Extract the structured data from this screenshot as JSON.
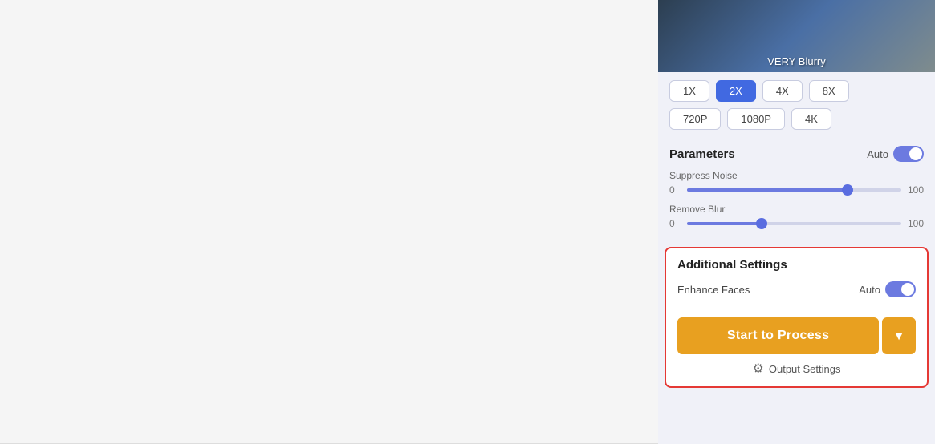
{
  "main_area": {
    "background": "#f5f5f5"
  },
  "image_preview": {
    "label": "VERY Blurry"
  },
  "scale_buttons": {
    "row1": [
      {
        "label": "1X",
        "active": false
      },
      {
        "label": "2X",
        "active": true
      },
      {
        "label": "4X",
        "active": false
      },
      {
        "label": "8X",
        "active": false
      }
    ],
    "row2": [
      {
        "label": "720P",
        "active": false
      },
      {
        "label": "1080P",
        "active": false
      },
      {
        "label": "4K",
        "active": false
      }
    ]
  },
  "parameters": {
    "title": "Parameters",
    "auto_label": "Auto",
    "suppress_noise": {
      "label": "Suppress Noise",
      "min": "0",
      "max": "100",
      "value": 75
    },
    "remove_blur": {
      "label": "Remove Blur",
      "min": "0",
      "max": "100",
      "value": 35
    }
  },
  "additional_settings": {
    "title": "Additional Settings",
    "enhance_faces": {
      "label": "Enhance Faces",
      "auto_label": "Auto"
    }
  },
  "process_button": {
    "label": "Start to Process",
    "dropdown_icon": "▼"
  },
  "output_settings": {
    "label": "Output Settings"
  }
}
